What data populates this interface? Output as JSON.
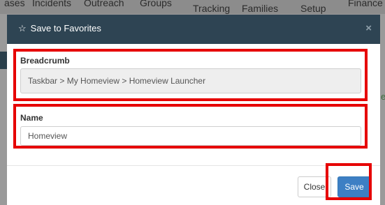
{
  "background": {
    "nav_items": [
      "ases",
      "Incidents",
      "Outreach",
      "Groups",
      "Tracking",
      "Families",
      "Setup",
      "Finance"
    ],
    "right_letter": "e"
  },
  "modal": {
    "title": "Save to Favorites",
    "icon": "star-outline-icon",
    "close_glyph": "×",
    "breadcrumb": {
      "label": "Breadcrumb",
      "value": "Taskbar > My Homeview > Homeview Launcher"
    },
    "name": {
      "label": "Name",
      "value": "Homeview"
    },
    "buttons": {
      "close_label": "Close",
      "save_label": "Save"
    }
  },
  "colors": {
    "header_bg": "#2e4453",
    "save_button": "#3d7fc4",
    "highlight": "#e60000"
  }
}
